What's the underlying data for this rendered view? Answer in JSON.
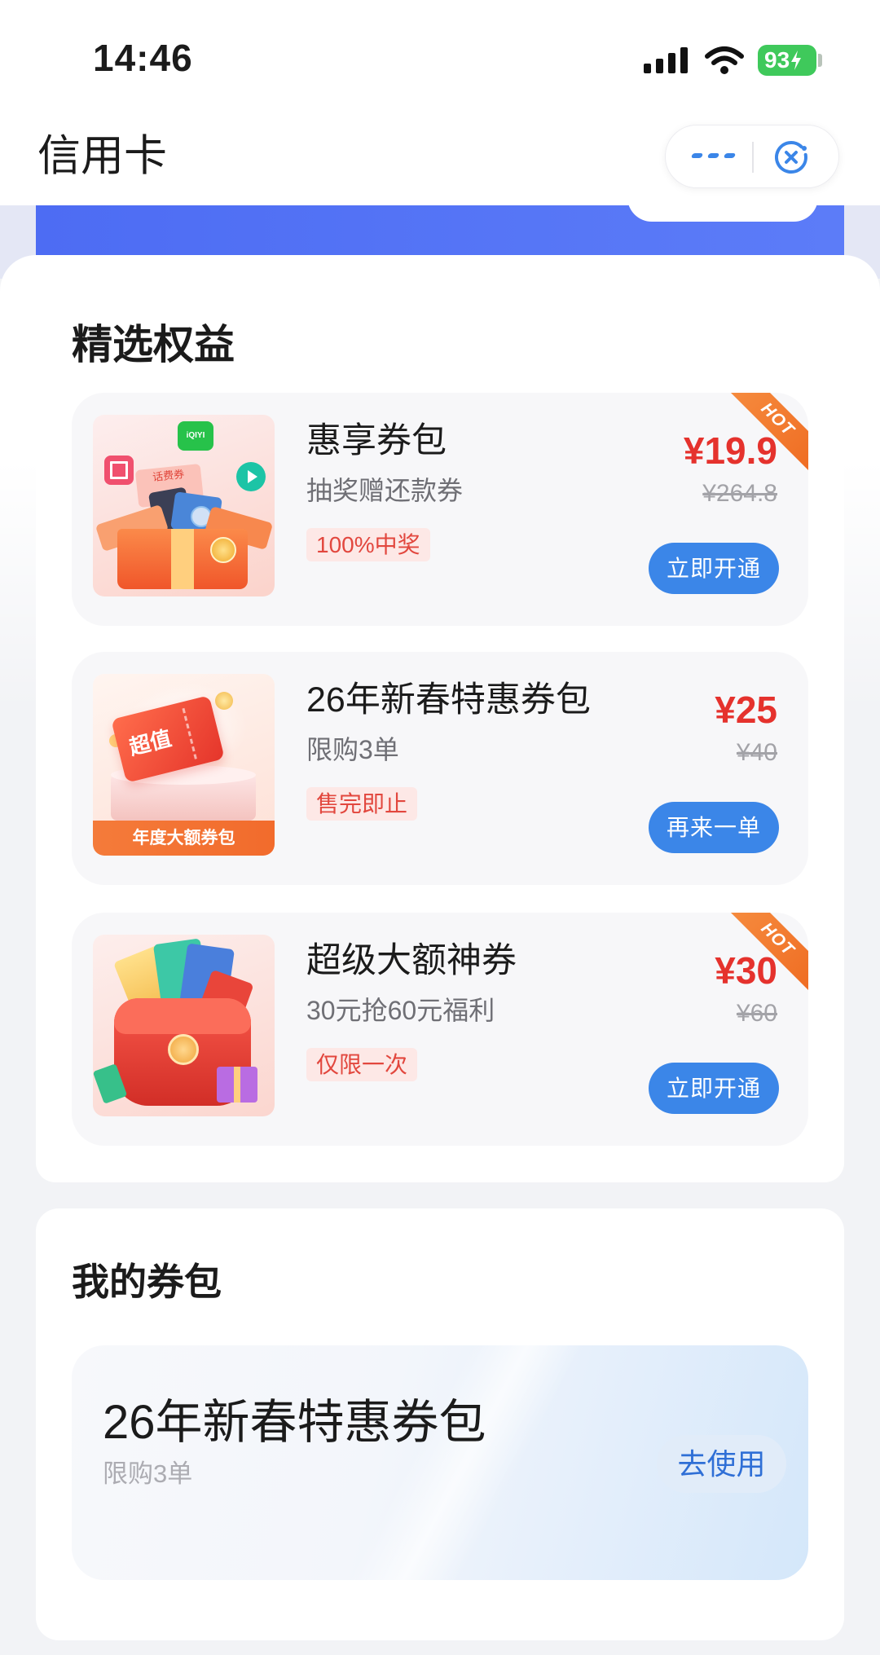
{
  "status_bar": {
    "time": "14:46",
    "battery": "93",
    "icons": {
      "signal": "signal-icon",
      "wifi": "wifi-icon",
      "battery": "battery-charging-icon"
    }
  },
  "header": {
    "title": "信用卡",
    "capsule_icons": {
      "more": "more-icon",
      "close": "close-icon"
    }
  },
  "featured": {
    "title": "精选权益",
    "items": [
      {
        "title": "惠享券包",
        "subtitle": "抽奖赠还款券",
        "tag": "100%中奖",
        "price": "¥19.9",
        "original_price": "¥264.8",
        "button": "立即开通",
        "badge": "HOT",
        "image_texts": [
          "iQIYI",
          "话费券"
        ]
      },
      {
        "title": "26年新春特惠券包",
        "subtitle": "限购3单",
        "tag": "售完即止",
        "price": "¥25",
        "original_price": "¥40",
        "button": "再来一单",
        "image_tag": "超值",
        "image_label": "年度大额券包"
      },
      {
        "title": "超级大额神券",
        "subtitle": "30元抢60元福利",
        "tag": "仅限一次",
        "price": "¥30",
        "original_price": "¥60",
        "button": "立即开通",
        "badge": "HOT"
      }
    ]
  },
  "my_coupons": {
    "title": "我的券包",
    "items": [
      {
        "title": "26年新春特惠券包",
        "subtitle": "限购3单",
        "button": "去使用"
      }
    ]
  },
  "colors": {
    "price_red": "#e5322d",
    "button_blue": "#3b86e8",
    "hot_orange": "#ef6c22",
    "tag_bg": "#fde8e6",
    "banner_blue": "#4d6cf3"
  }
}
